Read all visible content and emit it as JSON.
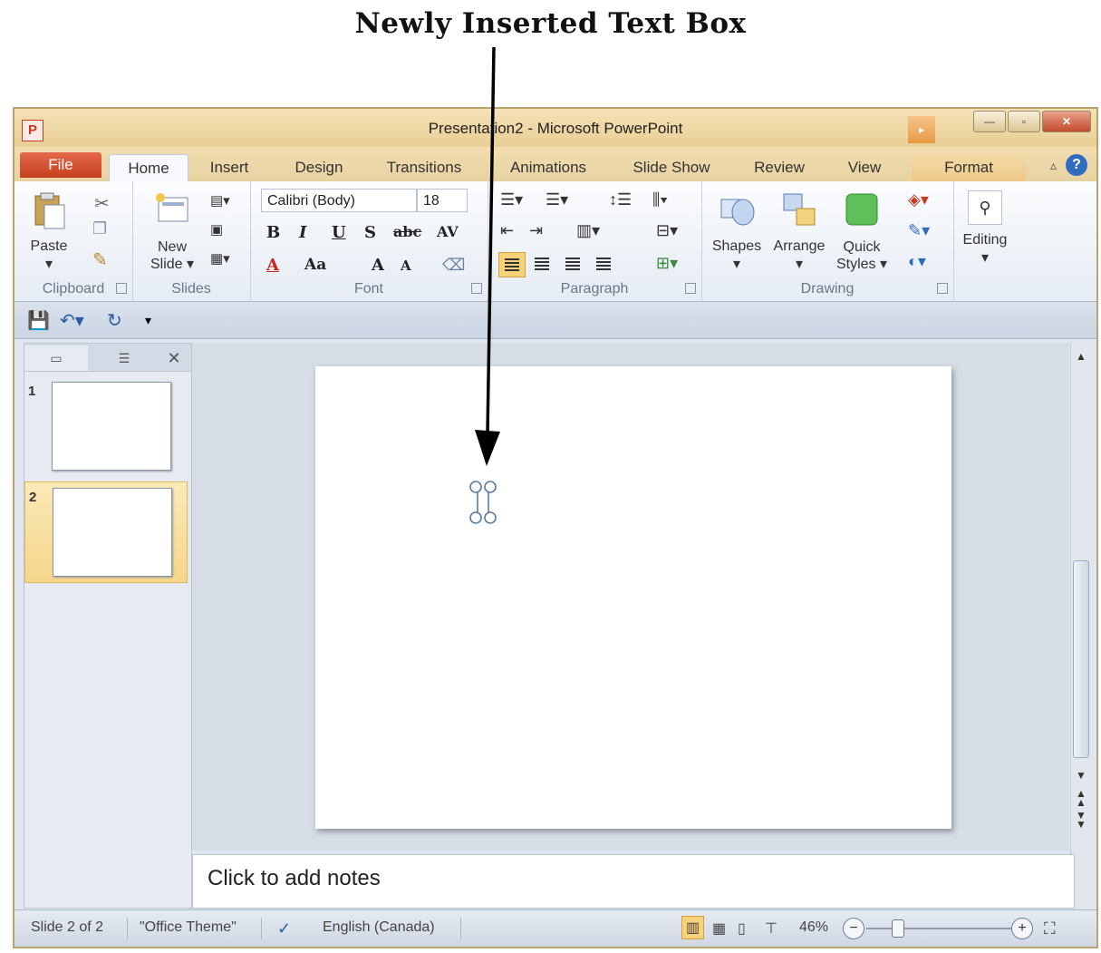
{
  "annotation": {
    "title": "Newly Inserted Text Box"
  },
  "window": {
    "title": "Presentation2 - Microsoft PowerPoint",
    "app_icon": "P",
    "controls": {
      "minimize": "—",
      "maximize": "▫",
      "close": "✕"
    }
  },
  "tabs": [
    "File",
    "Home",
    "Insert",
    "Design",
    "Transitions",
    "Animations",
    "Slide Show",
    "Review",
    "View",
    "Format"
  ],
  "active_tab": "Home",
  "ribbon": {
    "clipboard": {
      "label": "Clipboard",
      "paste": "Paste"
    },
    "slides": {
      "label": "Slides",
      "new_slide": "New\nSlide ▾"
    },
    "font": {
      "label": "Font",
      "font_name": "Calibri (Body)",
      "font_size": "18",
      "bold": "B",
      "italic": "I",
      "underline": "U",
      "shadow": "S",
      "strike": "abc",
      "spacing": "AV",
      "color": "A",
      "case": "Aa",
      "grow": "A",
      "shrink": "A"
    },
    "paragraph": {
      "label": "Paragraph"
    },
    "drawing": {
      "label": "Drawing",
      "shapes": "Shapes",
      "arrange": "Arrange",
      "quick_styles": "Quick\nStyles ▾"
    },
    "editing": {
      "label": "Editing"
    }
  },
  "thumbnails": [
    {
      "number": "1",
      "selected": false
    },
    {
      "number": "2",
      "selected": true
    }
  ],
  "notes": {
    "placeholder": "Click to add notes"
  },
  "status": {
    "slide": "Slide 2 of 2",
    "theme": "\"Office Theme\"",
    "language": "English (Canada)",
    "zoom": "46%"
  },
  "colors": {
    "file_tab": "#c5401f",
    "ribbon_bg": "#f7f9fc",
    "selected_thumb": "#f5d68a"
  }
}
